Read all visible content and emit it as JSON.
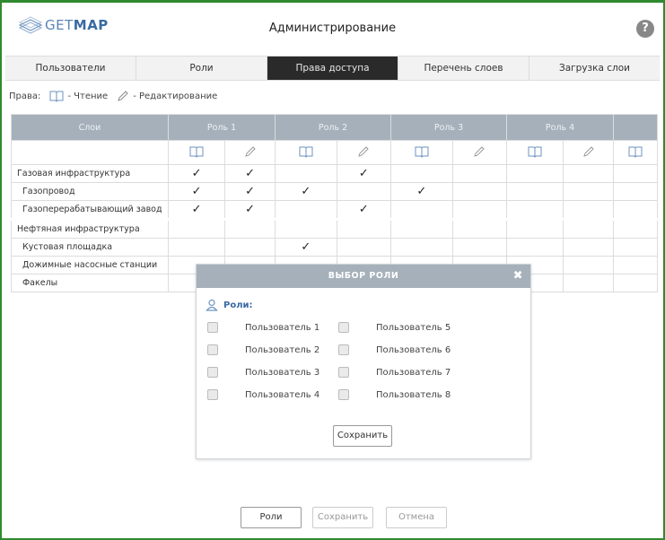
{
  "header": {
    "logo_prefix": "GET",
    "logo_bold": "MAP",
    "title": "Администрирование",
    "help_glyph": "?"
  },
  "tabs": [
    {
      "label": "Пользователи"
    },
    {
      "label": "Роли"
    },
    {
      "label": "Права доступа"
    },
    {
      "label": "Перечень слоев"
    },
    {
      "label": "Загрузка слои"
    }
  ],
  "legend": {
    "prefix": "Права:",
    "read": "- Чтение",
    "edit": "- Редактирование"
  },
  "grid": {
    "layers_header": "Слои",
    "roles": [
      "Роль 1",
      "Роль 2",
      "Роль 3",
      "Роль 4"
    ],
    "rows": [
      {
        "name": "Газовая инфраструктура",
        "checks": [
          true,
          true,
          false,
          true,
          false,
          false,
          false,
          false,
          false
        ]
      },
      {
        "name": "Газопровод",
        "checks": [
          true,
          true,
          true,
          false,
          true,
          false,
          false,
          false,
          false
        ]
      },
      {
        "name": "Газоперерабатывающий завод",
        "checks": [
          true,
          true,
          false,
          true,
          false,
          false,
          false,
          false,
          false
        ]
      },
      {
        "name": "Нефтяная инфраструктура",
        "checks": [
          false,
          false,
          false,
          false,
          false,
          false,
          false,
          false,
          false
        ]
      },
      {
        "name": "Кустовая площадка",
        "checks": [
          false,
          false,
          true,
          false,
          false,
          false,
          false,
          false,
          false
        ]
      },
      {
        "name": "Дожимные насосные станции",
        "checks": [
          false,
          false,
          false,
          false,
          false,
          false,
          false,
          false,
          false
        ]
      },
      {
        "name": "Факелы",
        "checks": [
          false,
          false,
          false,
          false,
          false,
          false,
          false,
          false,
          false
        ]
      }
    ],
    "check_glyph": "✓"
  },
  "modal": {
    "title": "ВЫБОР РОЛИ",
    "close_glyph": "✖",
    "roles_label": "Роли:",
    "users": [
      "Пользователь 1",
      "Пользователь 2",
      "Пользователь 3",
      "Пользователь 4",
      "Пользователь 5",
      "Пользователь 6",
      "Пользователь 7",
      "Пользователь 8"
    ],
    "save_label": "Сохранить"
  },
  "footer": {
    "roles_label": "Роли",
    "save_label": "Сохранить",
    "cancel_label": "Отмена"
  },
  "colors": {
    "frame": "#2f8a2f",
    "header_fill": "#a5b0ba",
    "active_tab": "#2a2a2a",
    "accent": "#3a6aa3"
  }
}
